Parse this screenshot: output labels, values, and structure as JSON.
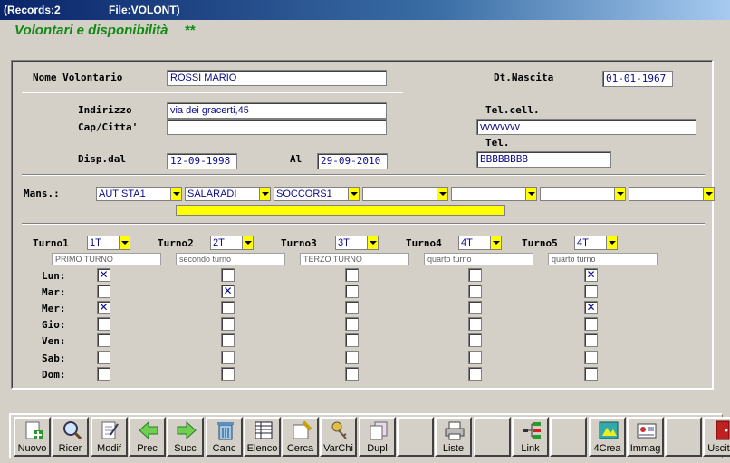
{
  "window": {
    "records": "(Records:2",
    "file": "File:VOLONT)"
  },
  "heading": {
    "title": "Volontari e disponibilità",
    "stars": "**"
  },
  "labels": {
    "nome": "Nome Volontario",
    "dt_nascita": "Dt.Nascita",
    "indirizzo": "Indirizzo",
    "cap": "Cap/Citta'",
    "tel_cell": "Tel.cell.",
    "tel": "Tel.",
    "disp_dal": "Disp.dal",
    "al": "Al",
    "mans": "Mans.:"
  },
  "fields": {
    "nome": "ROSSI MARIO",
    "dt_nascita": "01-01-1967",
    "indirizzo": "via dei gracerti,45",
    "cap": "",
    "tel_cell": "vvvvvvvv",
    "tel": "BBBBBBBB",
    "disp_dal": "12-09-1998",
    "al": "29-09-2010"
  },
  "mansioni": [
    "AUTISTA1",
    "SALARADI",
    "SOCCORS1",
    "",
    "",
    "",
    ""
  ],
  "turni": [
    {
      "label": "Turno1",
      "code": "1T",
      "desc": "PRIMO TURNO",
      "days": [
        true,
        false,
        true,
        false,
        false,
        false,
        false
      ]
    },
    {
      "label": "Turno2",
      "code": "2T",
      "desc": "secondo turno",
      "days": [
        false,
        true,
        false,
        false,
        false,
        false,
        false
      ]
    },
    {
      "label": "Turno3",
      "code": "3T",
      "desc": "TERZO TURNO",
      "days": [
        false,
        false,
        false,
        false,
        false,
        false,
        false
      ]
    },
    {
      "label": "Turno4",
      "code": "4T",
      "desc": "quarto turno",
      "days": [
        false,
        false,
        false,
        false,
        false,
        false,
        false
      ]
    },
    {
      "label": "Turno5",
      "code": "4T",
      "desc": "quarto turno",
      "days": [
        true,
        false,
        true,
        false,
        false,
        false,
        false
      ]
    }
  ],
  "days": [
    "Lun:",
    "Mar:",
    "Mer:",
    "Gio:",
    "Ven:",
    "Sab:",
    "Dom:"
  ],
  "toolbar": [
    {
      "label": "Nuovo",
      "icon": "new-doc-icon"
    },
    {
      "label": "Ricer",
      "icon": "magnifier-icon"
    },
    {
      "label": "Modif",
      "icon": "edit-doc-icon"
    },
    {
      "label": "Prec",
      "icon": "arrow-left-icon"
    },
    {
      "label": "Succ",
      "icon": "arrow-right-icon"
    },
    {
      "label": "Canc",
      "icon": "trash-icon"
    },
    {
      "label": "Elenco",
      "icon": "list-table-icon"
    },
    {
      "label": "Cerca",
      "icon": "search-doc-icon"
    },
    {
      "label": "VarChi",
      "icon": "keys-icon"
    },
    {
      "label": "Dupl",
      "icon": "duplicate-icon"
    },
    {
      "label": "",
      "icon": ""
    },
    {
      "label": "Liste",
      "icon": "printer-icon"
    },
    {
      "label": "",
      "icon": ""
    },
    {
      "label": "Link",
      "icon": "link-tree-icon"
    },
    {
      "label": "",
      "icon": ""
    },
    {
      "label": "4Crea",
      "icon": "create-icon"
    },
    {
      "label": "Immag",
      "icon": "image-card-icon"
    },
    {
      "label": "",
      "icon": ""
    },
    {
      "label": "Uscita",
      "icon": "exit-door-icon"
    }
  ]
}
